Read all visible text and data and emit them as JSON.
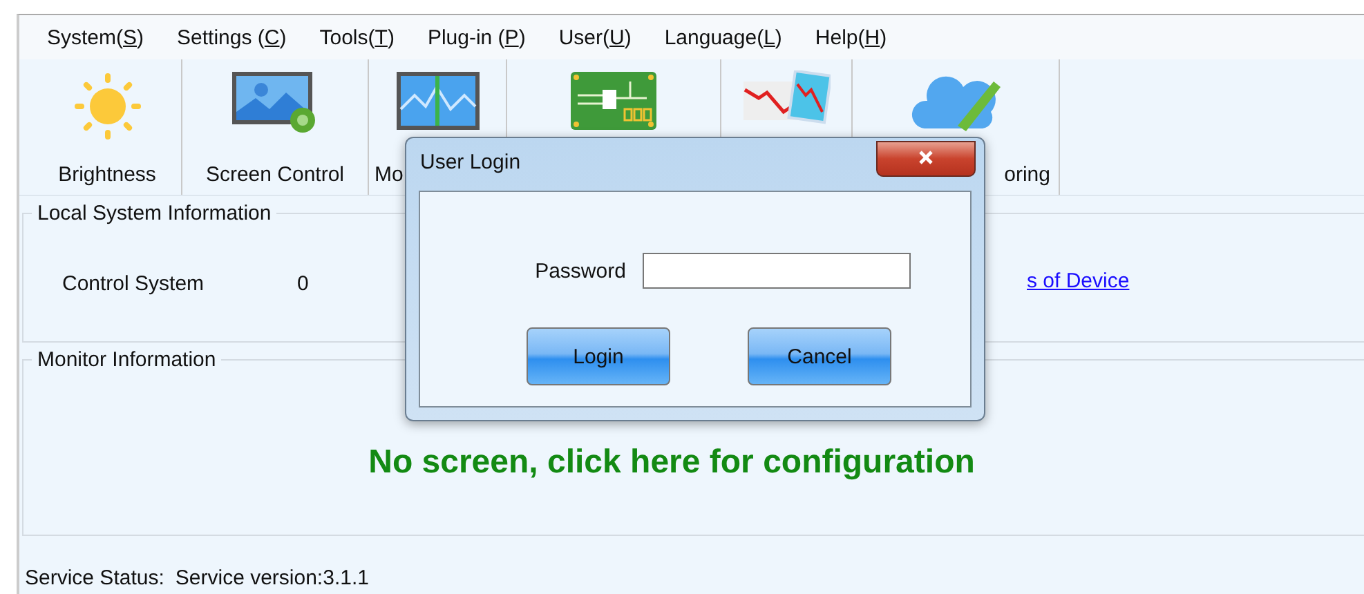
{
  "menu": [
    {
      "label": "System(S)"
    },
    {
      "label": "Settings (C)"
    },
    {
      "label": "Tools(T)"
    },
    {
      "label": "Plug-in (P)"
    },
    {
      "label": "User(U)"
    },
    {
      "label": "Language(L)"
    },
    {
      "label": "Help(H)"
    }
  ],
  "toolbar": [
    {
      "kind": "sun",
      "label": "Brightness"
    },
    {
      "kind": "picture",
      "label": "Screen Control"
    },
    {
      "kind": "monitor",
      "label": "Mo"
    },
    {
      "kind": "board"
    },
    {
      "kind": "chart"
    },
    {
      "kind": "cloud",
      "label": "oring"
    }
  ],
  "local_system": {
    "title": "Local System Information",
    "control_system_label": "Control System",
    "control_system_value": "0",
    "link": "s of Device"
  },
  "monitor": {
    "title": "Monitor Information",
    "message": "No screen, click here for configuration"
  },
  "status_bar": {
    "label": "Service Status:",
    "version": "Service version:3.1.1"
  },
  "dialog": {
    "title": "User Login",
    "password_label": "Password",
    "buttons": [
      "Login",
      "Cancel"
    ]
  }
}
